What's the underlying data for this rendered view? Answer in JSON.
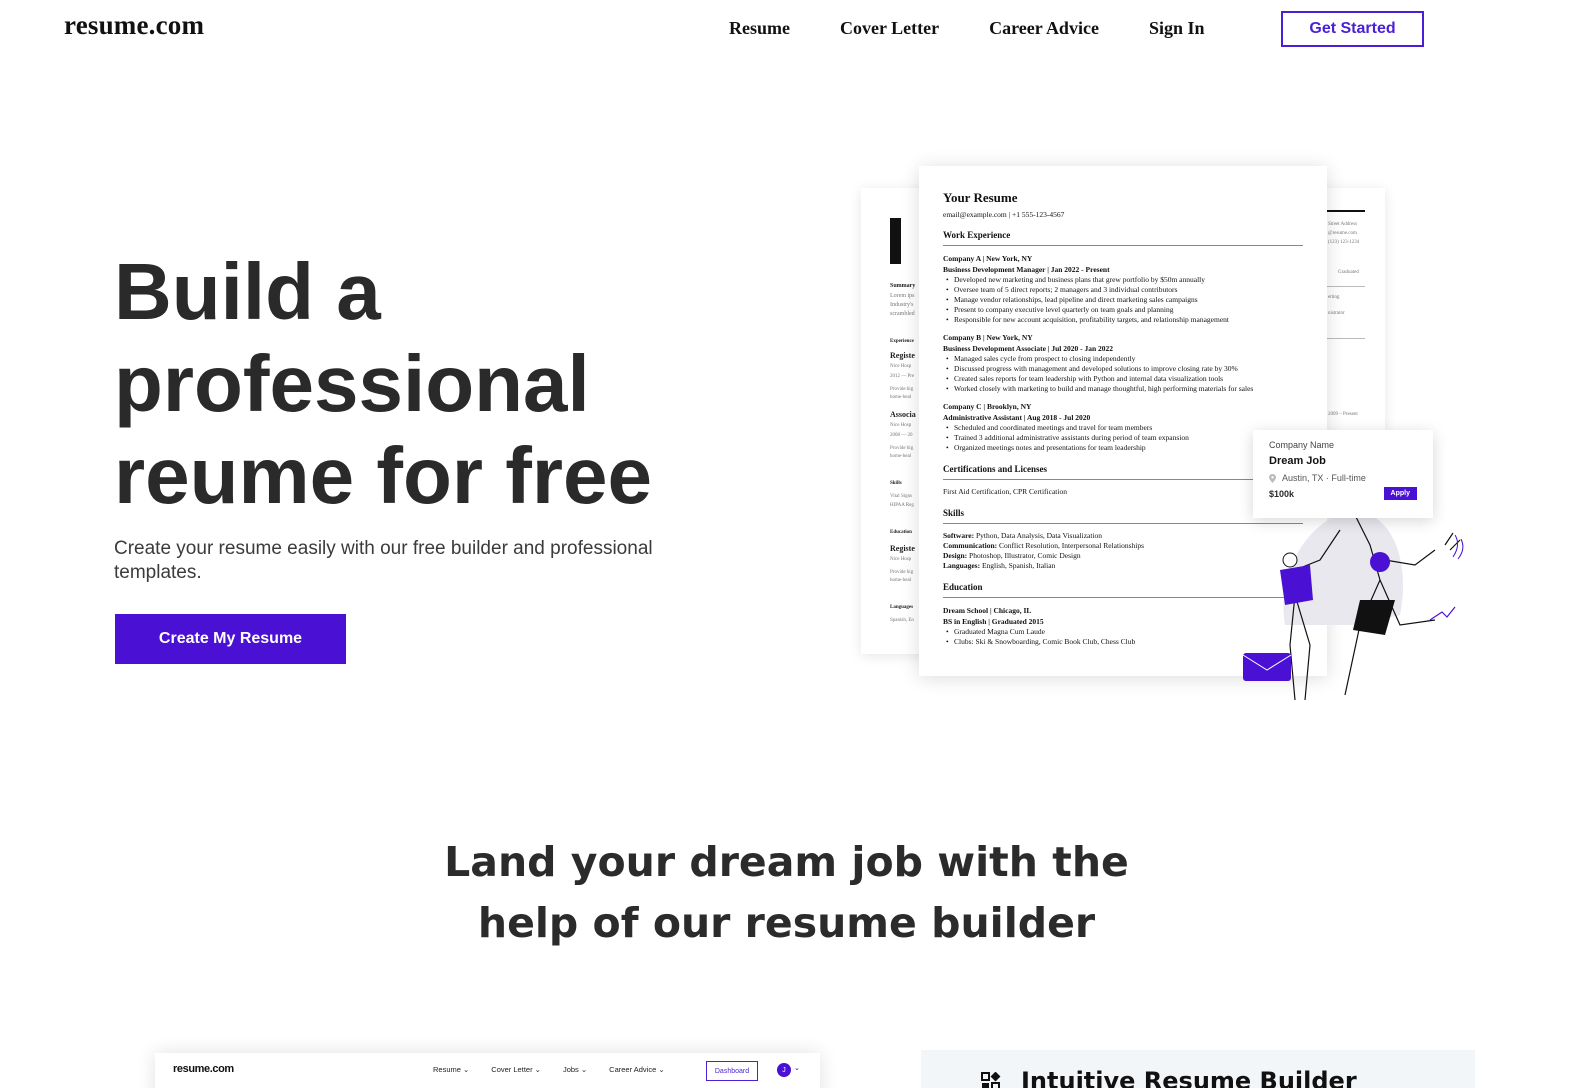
{
  "header": {
    "logo": "resume.com",
    "nav": [
      "Resume",
      "Cover Letter",
      "Career Advice",
      "Sign In"
    ],
    "cta": "Get Started"
  },
  "hero": {
    "title_lines": [
      "Build a",
      "professional",
      "reume for free"
    ],
    "subtitle": "Create your resume easily with our free builder and professional templates.",
    "cta": "Create My Resume"
  },
  "resume_preview": {
    "name": "Your Resume",
    "contact": "email@example.com  |  +1 555-123-4567",
    "work_heading": "Work Experience",
    "jobs": [
      {
        "company": "Company A  |  New York, NY",
        "role": "Business Development Manager  |  Jan 2022 - Present",
        "bullets": [
          "Developed new marketing and business plans that grew portfolio by $50m annually",
          "Oversee team of 5 direct reports; 2 managers and 3 individual contributors",
          "Manage vendor relationships, lead pipeline and direct marketing sales campaigns",
          "Present to company executive level quarterly on team goals and planning",
          "Responsible for new account acquisition, profitability targets, and relationship management"
        ]
      },
      {
        "company": "Company B  |  New York, NY",
        "role": "Business Development Associate  |  Jul 2020 - Jan 2022",
        "bullets": [
          "Managed sales cycle from prospect to closing independently",
          "Discussed progress with management and developed solutions to improve closing rate by 30%",
          "Created sales reports for team leadership with Python and internal data visualization tools",
          "Worked closely with marketing to build and manage thoughtful, high performing materials for sales"
        ]
      },
      {
        "company": "Company C  |  Brooklyn, NY",
        "role": "Administrative Assistant  |  Aug 2018 - Jul 2020",
        "bullets": [
          "Scheduled and coordinated meetings and travel for team members",
          "Trained 3 additional administrative assistants during period of team expansion",
          "Organized meetings notes and presentations for team leadership"
        ]
      }
    ],
    "certs_heading": "Certifications and Licenses",
    "certs": "First Aid Certification, CPR Certification",
    "skills_heading": "Skills",
    "skills": [
      {
        "label": "Software:",
        "value": "Python, Data Analysis, Data Visualization"
      },
      {
        "label": "Communication:",
        "value": "Conflict Resolution, Interpersonal Relationships"
      },
      {
        "label": "Design:",
        "value": "Photoshop, Illustrator, Comic Design"
      },
      {
        "label": "Languages:",
        "value": "English, Spanish, Italian"
      }
    ],
    "education_heading": "Education",
    "school": "Dream School  |  Chicago, IL",
    "degree": "BS in English  |  Graduated 2015",
    "edu_bullets": [
      "Graduated Magna Cum Laude",
      "Clubs: Ski & Snowboarding, Comic Book Club, Chess Club"
    ]
  },
  "bg_resume_left": {
    "summary": "Summary",
    "summary_lines": [
      "Lorem ips",
      "Industry's",
      "scrambled"
    ],
    "experience": "Experience",
    "job1": "Registe",
    "job1_lines": [
      "Nice Hosp",
      "2012 — Pre",
      "Provide hig",
      "home-heal"
    ],
    "job2": "Associa",
    "job2_lines": [
      "Nice Hosp",
      "2008 — 20",
      "Provide hig",
      "home-heal"
    ],
    "skills": "Skills",
    "skills_lines": [
      "Vital Signs",
      "HIPAA Reg"
    ],
    "education": "Education",
    "edu_title": "Registe",
    "edu_lines": [
      "Nice Hosp",
      "Provide hig",
      "home-heal"
    ],
    "languages": "Languages",
    "languages_line": "Spanish, En"
  },
  "bg_resume_right": {
    "lines": [
      "Street Address",
      "@resume.com",
      "(123) 123-1234",
      "Graduated",
      "etting",
      "nistrator",
      "2009 – Present"
    ]
  },
  "job_card": {
    "company": "Company Name",
    "title": "Dream Job",
    "location": "Austin, TX · Full-time",
    "salary": "$100k",
    "apply": "Apply"
  },
  "section2": {
    "title_lines": [
      "Land your dream job with the",
      "help of our resume builder"
    ]
  },
  "app_preview": {
    "logo": "resume.com",
    "nav": [
      "Resume ⌄",
      "Cover Letter ⌄",
      "Jobs ⌄",
      "Career Advice ⌄"
    ],
    "dashboard": "Dashboard",
    "avatar": "J"
  },
  "feature": {
    "title": "Intuitive Resume Builder"
  },
  "colors": {
    "accent": "#4a10d4",
    "text": "#2b2b2b",
    "panel_bg": "#f3f6f8"
  }
}
